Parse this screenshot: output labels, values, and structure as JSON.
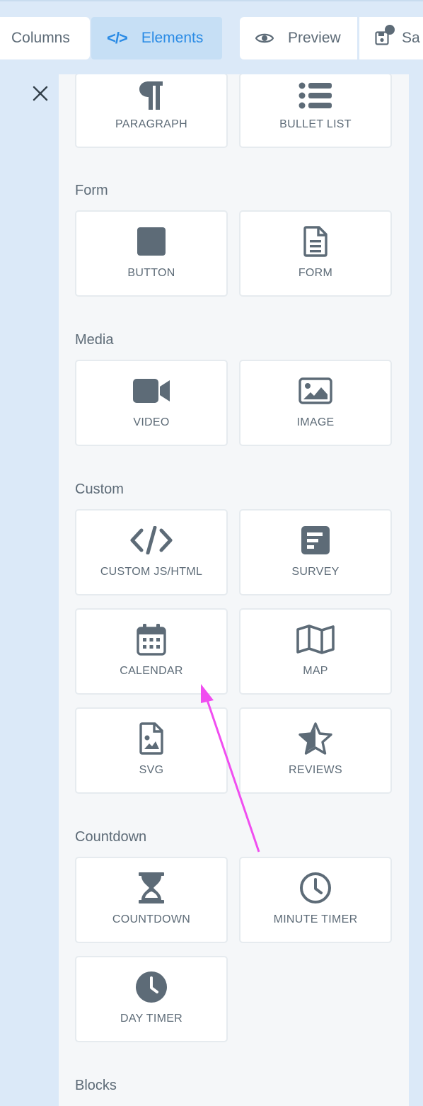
{
  "toolbar": {
    "columns_label": "Columns",
    "elements_label": "Elements",
    "preview_label": "Preview",
    "save_label": "Sa"
  },
  "sections": {
    "text": {
      "items": [
        {
          "label": "PARAGRAPH",
          "icon": "paragraph-icon"
        },
        {
          "label": "BULLET LIST",
          "icon": "bullet-list-icon"
        }
      ]
    },
    "form": {
      "title": "Form",
      "items": [
        {
          "label": "BUTTON",
          "icon": "button-icon"
        },
        {
          "label": "FORM",
          "icon": "form-icon"
        }
      ]
    },
    "media": {
      "title": "Media",
      "items": [
        {
          "label": "VIDEO",
          "icon": "video-icon"
        },
        {
          "label": "IMAGE",
          "icon": "image-icon"
        }
      ]
    },
    "custom": {
      "title": "Custom",
      "items": [
        {
          "label": "CUSTOM JS/HTML",
          "icon": "code-icon"
        },
        {
          "label": "SURVEY",
          "icon": "survey-icon"
        },
        {
          "label": "CALENDAR",
          "icon": "calendar-icon"
        },
        {
          "label": "MAP",
          "icon": "map-icon"
        },
        {
          "label": "SVG",
          "icon": "svg-file-icon"
        },
        {
          "label": "REVIEWS",
          "icon": "star-icon"
        }
      ]
    },
    "countdown": {
      "title": "Countdown",
      "items": [
        {
          "label": "COUNTDOWN",
          "icon": "hourglass-icon"
        },
        {
          "label": "MINUTE TIMER",
          "icon": "clock-outline-icon"
        },
        {
          "label": "DAY TIMER",
          "icon": "clock-filled-icon"
        }
      ]
    },
    "blocks": {
      "title": "Blocks"
    }
  },
  "colors": {
    "accent": "#2a8be5",
    "icon": "#5d6b77",
    "annotation_arrow": "#f04ef0"
  }
}
